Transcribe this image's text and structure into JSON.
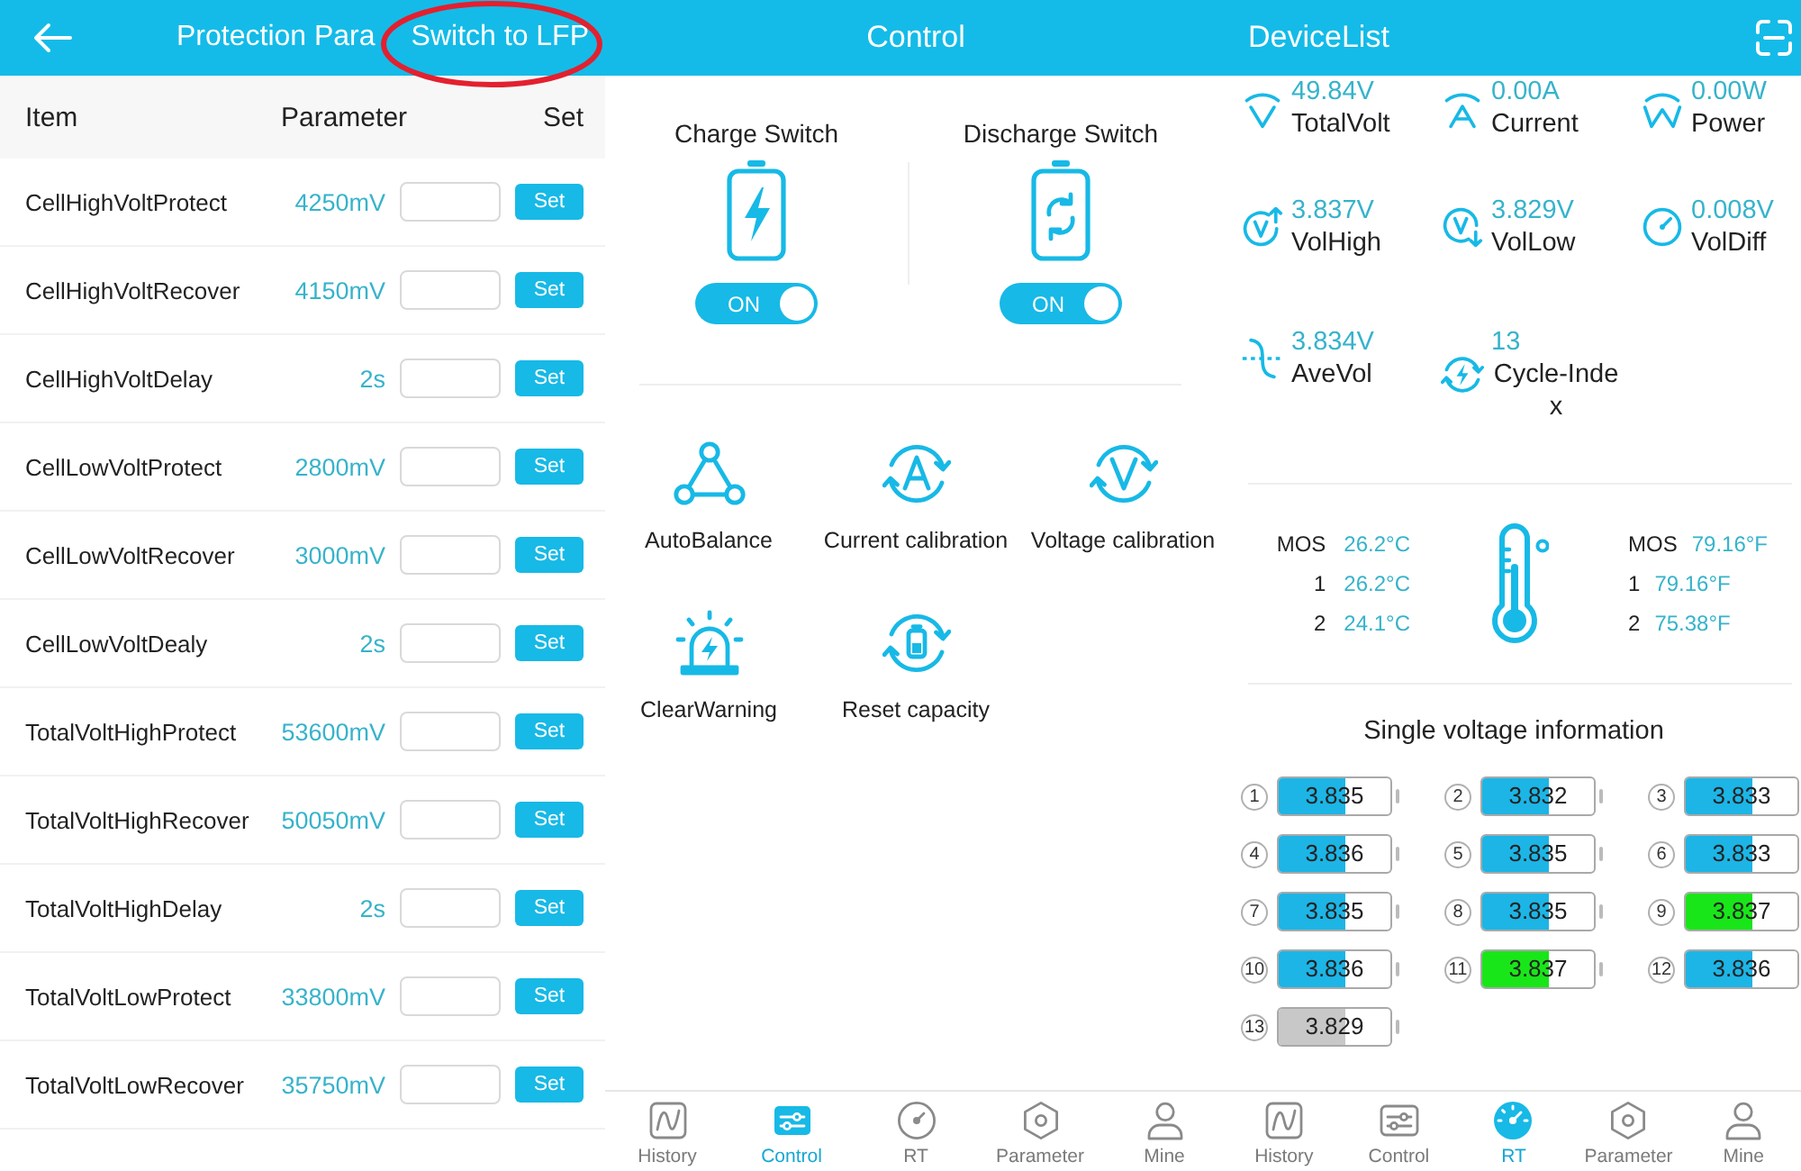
{
  "left_screen": {
    "header": {
      "title": "Protection Para",
      "action": "Switch to LFP"
    },
    "table": {
      "columns": [
        "Item",
        "Parameter",
        "Set"
      ],
      "rows": [
        {
          "item": "CellHighVoltProtect",
          "parameter": "4250mV",
          "button": "Set"
        },
        {
          "item": "CellHighVoltRecover",
          "parameter": "4150mV",
          "button": "Set"
        },
        {
          "item": "CellHighVoltDelay",
          "parameter": "2s",
          "button": "Set"
        },
        {
          "item": "CellLowVoltProtect",
          "parameter": "2800mV",
          "button": "Set"
        },
        {
          "item": "CellLowVoltRecover",
          "parameter": "3000mV",
          "button": "Set"
        },
        {
          "item": "CellLowVoltDealy",
          "parameter": "2s",
          "button": "Set"
        },
        {
          "item": "TotalVoltHighProtect",
          "parameter": "53600mV",
          "button": "Set"
        },
        {
          "item": "TotalVoltHighRecover",
          "parameter": "50050mV",
          "button": "Set"
        },
        {
          "item": "TotalVoltHighDelay",
          "parameter": "2s",
          "button": "Set"
        },
        {
          "item": "TotalVoltLowProtect",
          "parameter": "33800mV",
          "button": "Set"
        },
        {
          "item": "TotalVoltLowRecover",
          "parameter": "35750mV",
          "button": "Set"
        }
      ]
    }
  },
  "middle_screen": {
    "title": "Control",
    "switches": [
      {
        "label": "Charge Switch",
        "on": true,
        "state_text": "ON"
      },
      {
        "label": "Discharge Switch",
        "on": true,
        "state_text": "ON"
      }
    ],
    "actions": [
      "AutoBalance",
      "Current calibration",
      "Voltage calibration",
      "ClearWarning",
      "Reset capacity"
    ],
    "bottom_nav": [
      {
        "label": "History",
        "selected": false
      },
      {
        "label": "Control",
        "selected": true
      },
      {
        "label": "RT",
        "selected": false
      },
      {
        "label": "Parameter",
        "selected": false
      },
      {
        "label": "Mine",
        "selected": false
      }
    ]
  },
  "right_screen": {
    "title": "DeviceList",
    "metrics": [
      {
        "value": "49.84V",
        "label": "TotalVolt"
      },
      {
        "value": "0.00A",
        "label": "Current"
      },
      {
        "value": "0.00W",
        "label": "Power"
      },
      {
        "value": "3.837V",
        "label": "VolHigh"
      },
      {
        "value": "3.829V",
        "label": "VolLow"
      },
      {
        "value": "0.008V",
        "label": "VolDiff"
      },
      {
        "value": "3.834V",
        "label": "AveVol"
      },
      {
        "value": "13",
        "label": "Cycle-Index"
      }
    ],
    "temperatures_celsius": [
      {
        "label": "MOS",
        "value": "26.2°C"
      },
      {
        "label": "1",
        "value": "26.2°C"
      },
      {
        "label": "2",
        "value": "24.1°C"
      }
    ],
    "temperatures_fahrenheit": [
      {
        "label": "MOS",
        "value": "79.16°F"
      },
      {
        "label": "1",
        "value": "79.16°F"
      },
      {
        "label": "2",
        "value": "75.38°F"
      }
    ],
    "cells_title": "Single voltage information",
    "cells": [
      {
        "number": "1",
        "value": "3.835",
        "level": 0.6,
        "color": "#1cb5e6"
      },
      {
        "number": "2",
        "value": "3.832",
        "level": 0.6,
        "color": "#1cb5e6"
      },
      {
        "number": "3",
        "value": "3.833",
        "level": 0.6,
        "color": "#1cb5e6"
      },
      {
        "number": "4",
        "value": "3.836",
        "level": 0.6,
        "color": "#1cb5e6"
      },
      {
        "number": "5",
        "value": "3.835",
        "level": 0.6,
        "color": "#1cb5e6"
      },
      {
        "number": "6",
        "value": "3.833",
        "level": 0.6,
        "color": "#1cb5e6"
      },
      {
        "number": "7",
        "value": "3.835",
        "level": 0.6,
        "color": "#1cb5e6"
      },
      {
        "number": "8",
        "value": "3.835",
        "level": 0.6,
        "color": "#1cb5e6"
      },
      {
        "number": "9",
        "value": "3.837",
        "level": 0.6,
        "color": "#19e619"
      },
      {
        "number": "10",
        "value": "3.836",
        "level": 0.6,
        "color": "#1cb5e6"
      },
      {
        "number": "11",
        "value": "3.837",
        "level": 0.6,
        "color": "#19e619"
      },
      {
        "number": "12",
        "value": "3.836",
        "level": 0.6,
        "color": "#1cb5e6"
      },
      {
        "number": "13",
        "value": "3.829",
        "level": 0.6,
        "color": "#c8c8c8"
      }
    ],
    "bottom_nav": [
      {
        "label": "History",
        "selected": false
      },
      {
        "label": "Control",
        "selected": false
      },
      {
        "label": "RT",
        "selected": true
      },
      {
        "label": "Parameter",
        "selected": false
      },
      {
        "label": "Mine",
        "selected": false
      }
    ]
  }
}
